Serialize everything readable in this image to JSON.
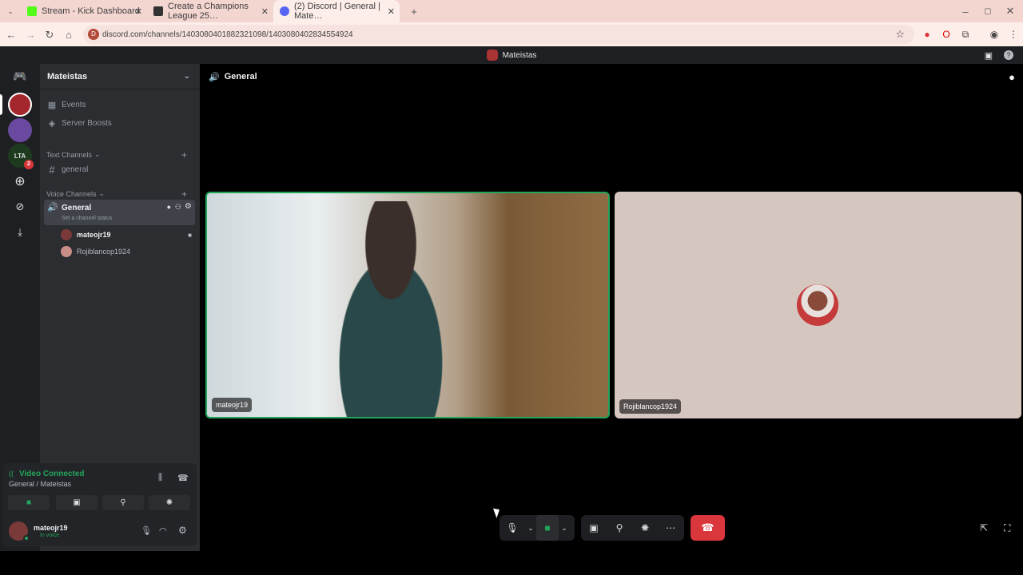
{
  "browser": {
    "tabs": [
      {
        "title": "Stream - Kick Dashboard",
        "favicon_color": "#53fc18"
      },
      {
        "title": "Create a Champions League 25…",
        "favicon_color": "#333333"
      },
      {
        "title": "(2) Discord | General | Mate…",
        "favicon_color": "#5865f2"
      }
    ],
    "url": "discord.com/channels/1403080401882321098/1403080402834554924"
  },
  "app": {
    "title": "Mateistas"
  },
  "server": {
    "name": "Mateistas",
    "events_label": "Events",
    "boosts_label": "Server Boosts",
    "text_category": "Text Channels",
    "text_channel": "general",
    "voice_category": "Voice Channels",
    "voice_channel": "General",
    "voice_status": "Set a channel status",
    "members": [
      {
        "name": "mateojr19",
        "color": "#f2f3f5"
      },
      {
        "name": "Rojiblancop1924",
        "color": "#b5bac1"
      }
    ]
  },
  "connection": {
    "status": "Video Connected",
    "location": "General / Mateistas"
  },
  "self_user": {
    "name": "mateojr19",
    "status": "In voice"
  },
  "channel_header": {
    "name": "General"
  },
  "tiles": [
    {
      "label": "mateojr19"
    },
    {
      "label": "Rojiblancop1924"
    }
  ],
  "rail": {
    "lta_label": "LTA",
    "lta_badge": "2"
  },
  "colors": {
    "accent_green": "#23a55a",
    "hangup": "#da373c",
    "tile_bg": "#d5c6c0"
  }
}
